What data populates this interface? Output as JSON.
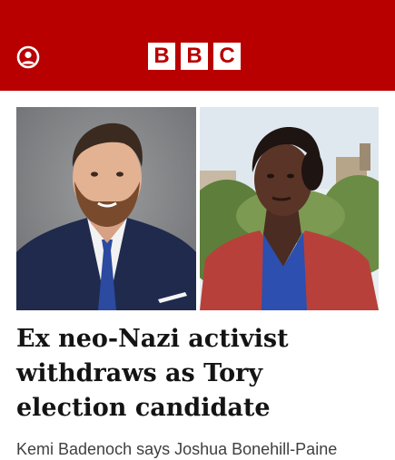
{
  "header": {
    "background_color": "#b80000",
    "account_icon": "account-icon",
    "logo": [
      "B",
      "B",
      "C"
    ]
  },
  "article": {
    "headline": "Ex neo-Nazi activist withdraws as Tory election candidate",
    "summary": "Kemi Badenoch says Joshua Bonehill-Paine"
  }
}
